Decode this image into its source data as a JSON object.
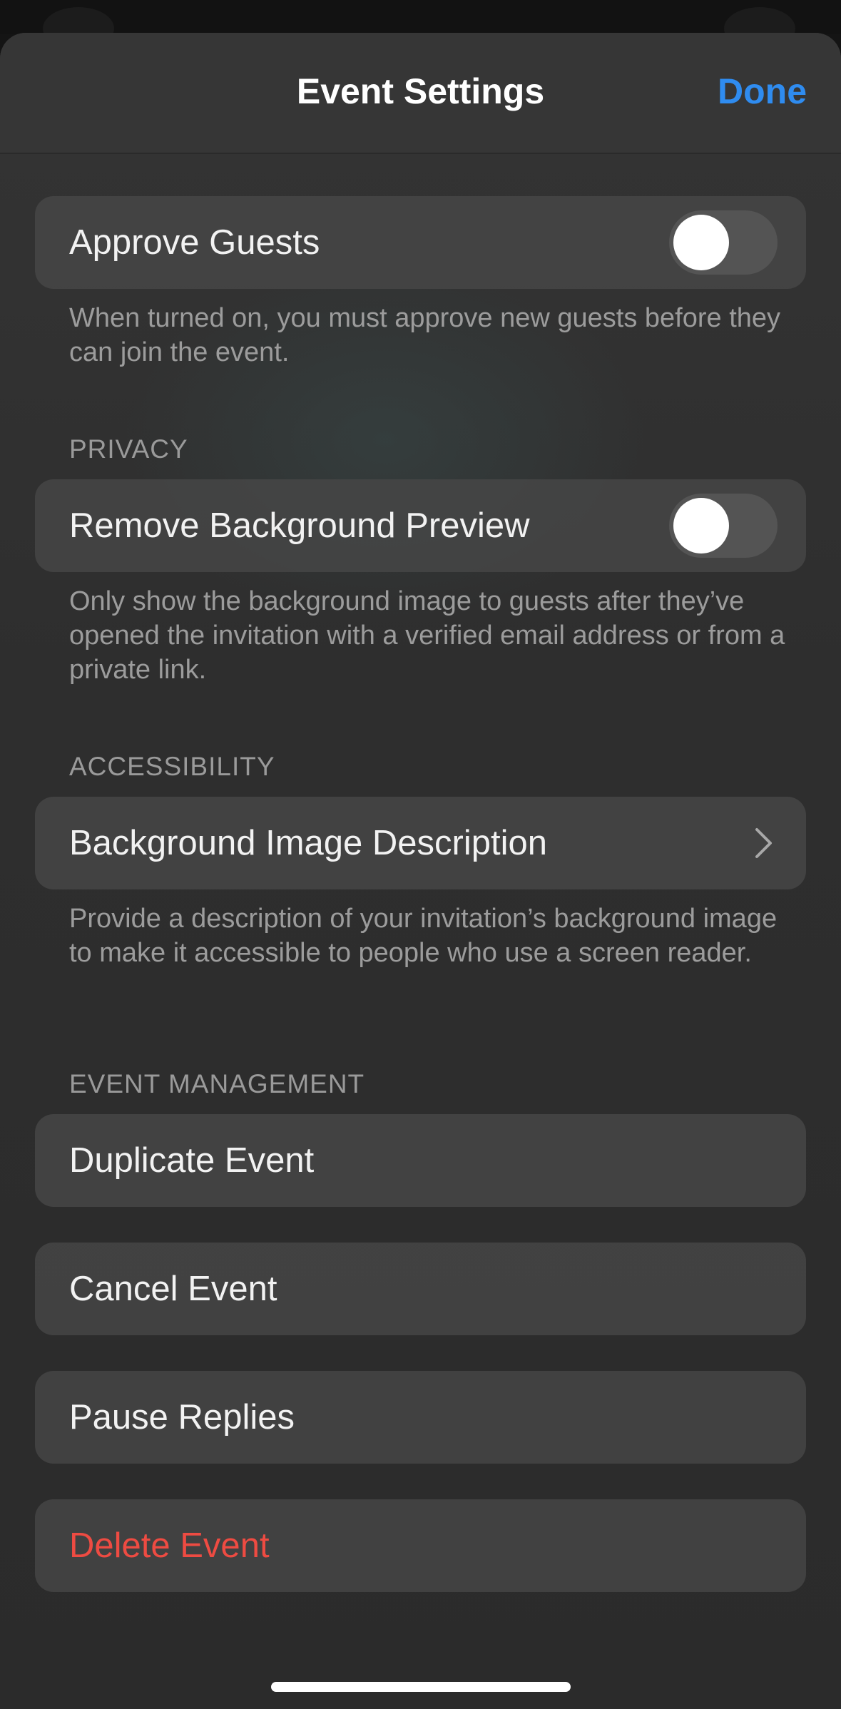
{
  "header": {
    "title": "Event Settings",
    "done_label": "Done"
  },
  "approve_guests": {
    "label": "Approve Guests",
    "toggle_on": false,
    "footnote": "When turned on, you must approve new guests before they can join the event."
  },
  "privacy": {
    "section": "PRIVACY",
    "label": "Remove Background Preview",
    "toggle_on": false,
    "footnote": "Only show the background image to guests after they’ve opened the invitation with a verified email address or from a private link."
  },
  "accessibility": {
    "section": "ACCESSIBILITY",
    "label": "Background Image Description",
    "chevron_icon": "chevron-right-icon",
    "footnote": "Provide a description of your invitation’s background image to make it accessible to people who use a screen reader."
  },
  "event_management": {
    "section": "EVENT MANAGEMENT",
    "duplicate": "Duplicate Event",
    "cancel": "Cancel Event",
    "pause": "Pause Replies",
    "delete": "Delete Event"
  },
  "colors": {
    "accent": "#2f8cf0",
    "destructive": "#ee4b42",
    "toggle_off": "#545454"
  }
}
